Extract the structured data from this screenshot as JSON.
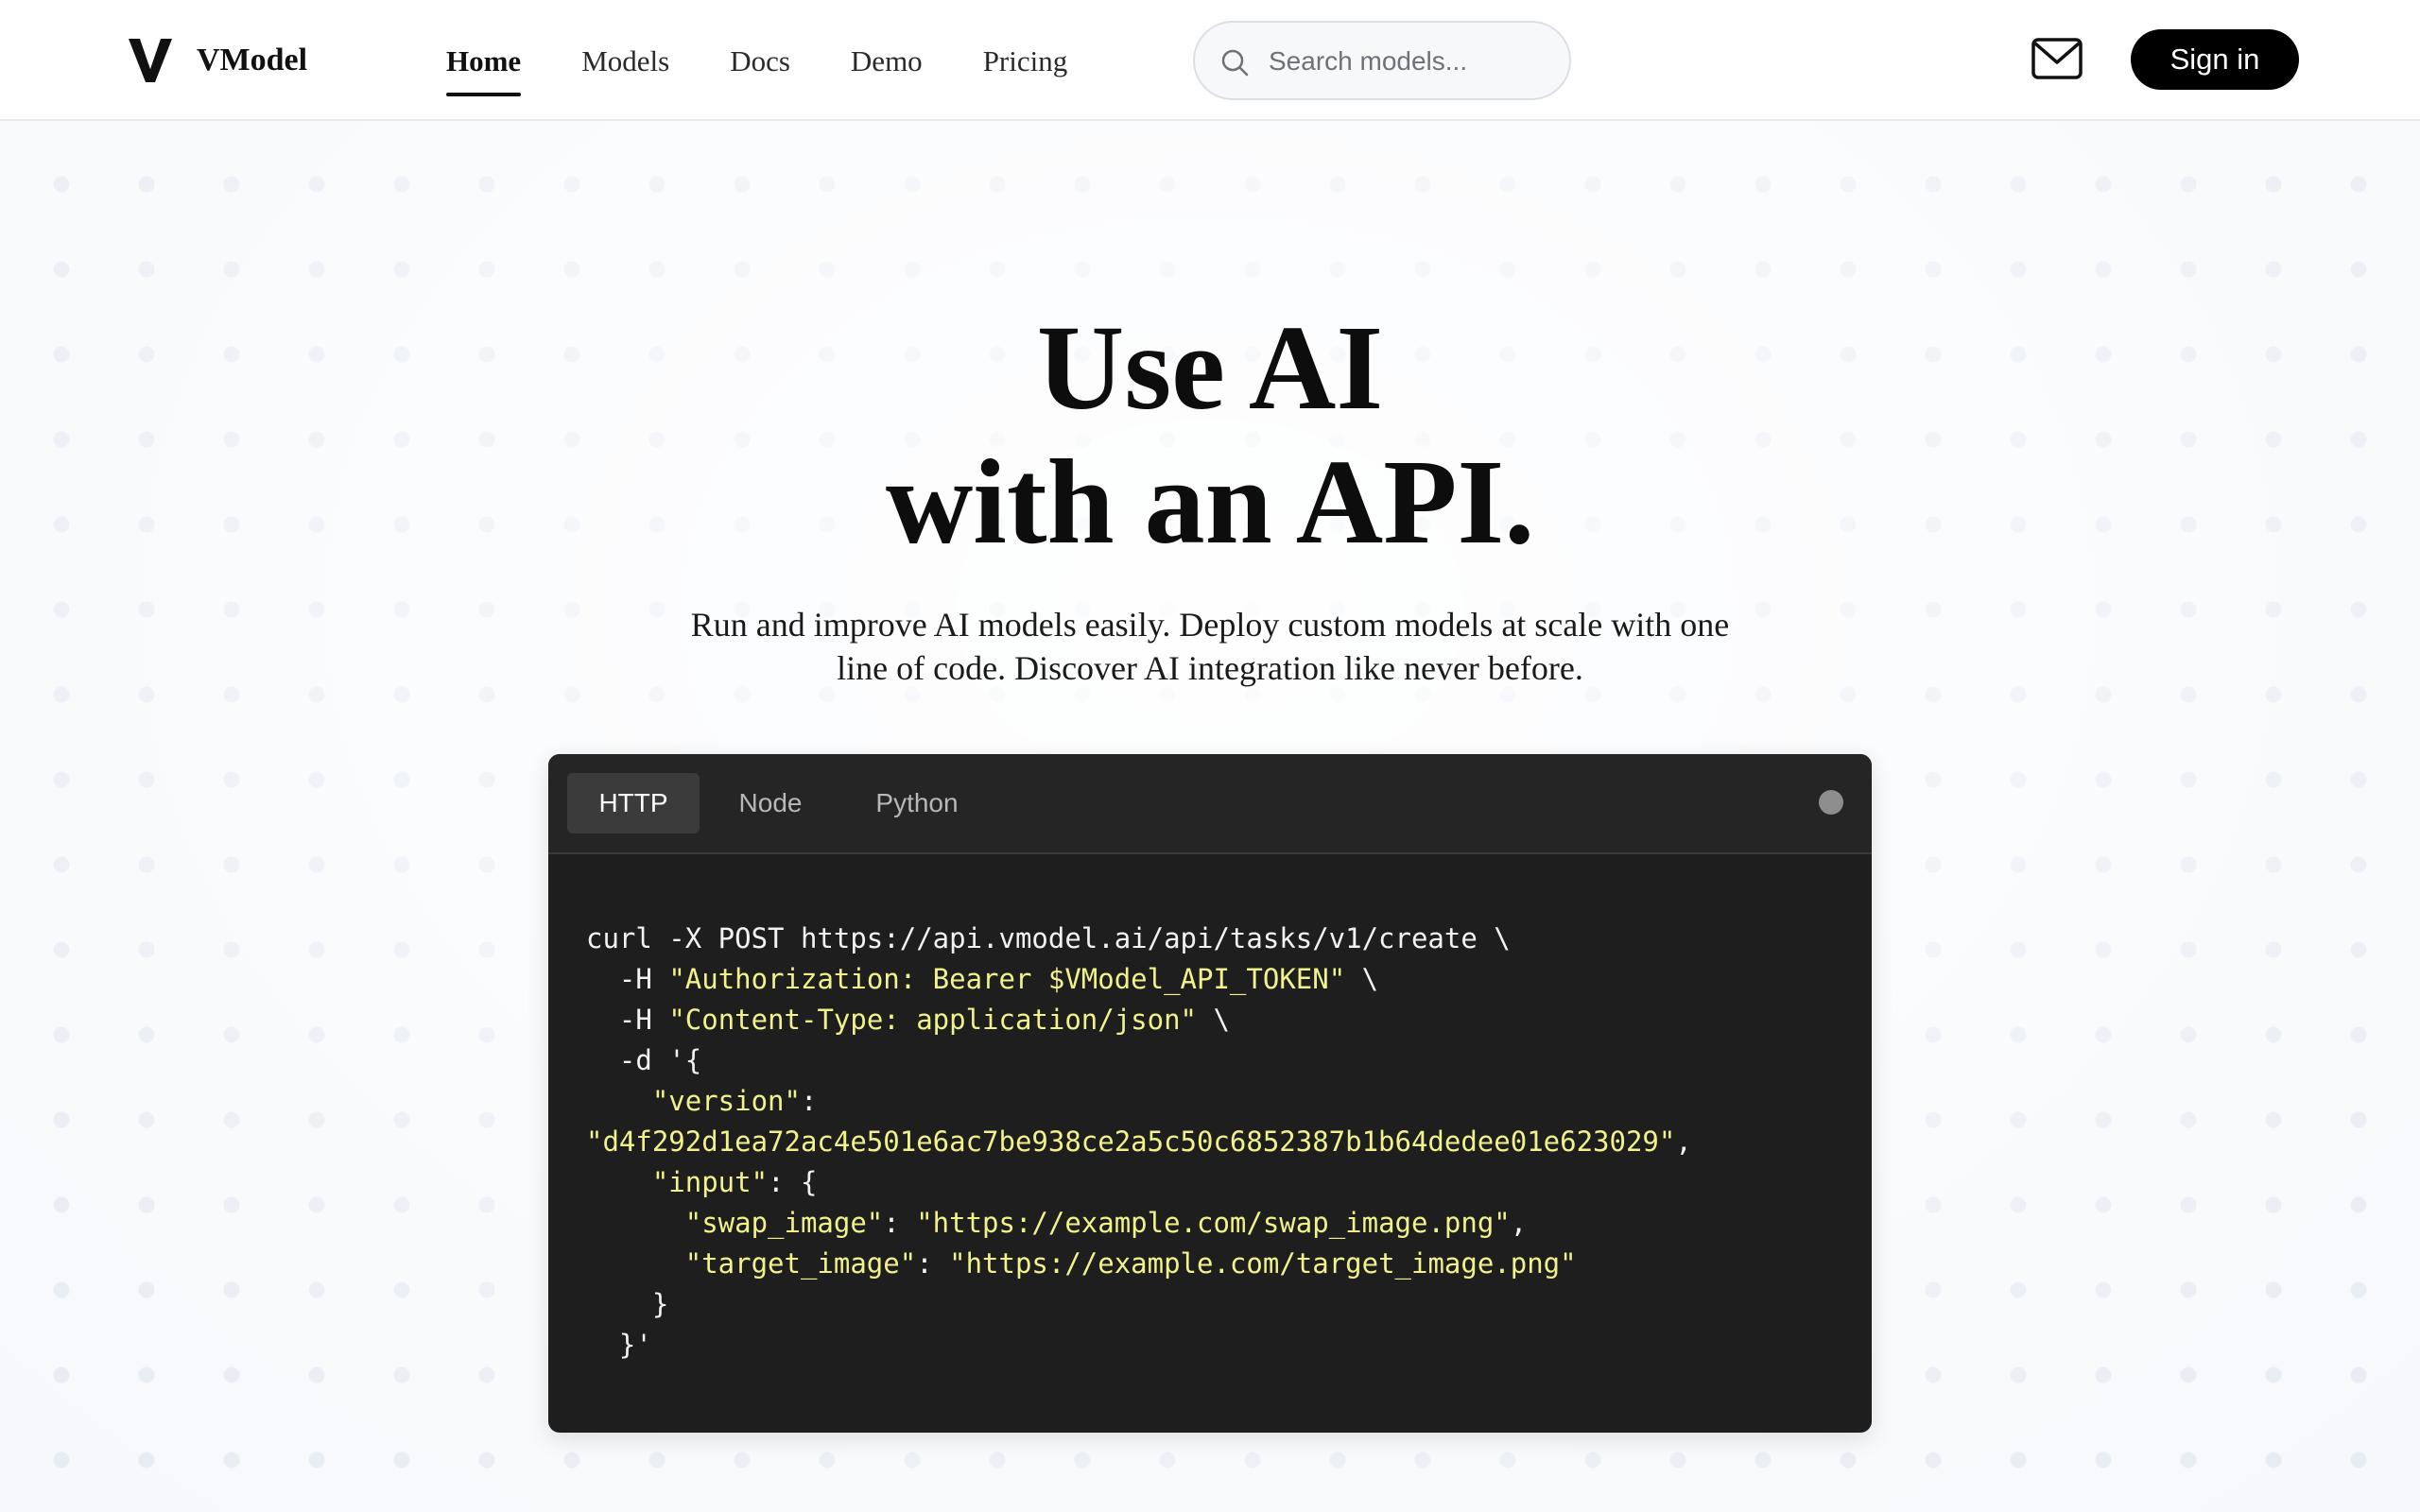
{
  "brand": {
    "name": "VModel"
  },
  "nav": {
    "items": [
      {
        "label": "Home",
        "active": true
      },
      {
        "label": "Models"
      },
      {
        "label": "Docs"
      },
      {
        "label": "Demo"
      },
      {
        "label": "Pricing"
      }
    ]
  },
  "search": {
    "placeholder": "Search models..."
  },
  "header": {
    "signin_label": "Sign in",
    "mail_icon": "mail-icon"
  },
  "hero": {
    "title_line1": "Use AI",
    "title_line2": "with an API.",
    "subtitle_line1": "Run and improve AI models easily. Deploy custom models at scale with one",
    "subtitle_line2": "line of code. Discover AI integration like never before."
  },
  "code_panel": {
    "tabs": [
      "HTTP",
      "Node",
      "Python"
    ],
    "active_tab": "HTTP",
    "lines": {
      "l1": "curl -X POST https://api.vmodel.ai/api/tasks/v1/create \\",
      "l2a": "  -H ",
      "l2s": "\"Authorization: Bearer $VModel_API_TOKEN\"",
      "l2b": " \\",
      "l3a": "  -H ",
      "l3s": "\"Content-Type: application/json\"",
      "l3b": " \\",
      "l4": "  -d '{",
      "l5s": "    \"version\"",
      "l5b": ":",
      "l6s": "\"d4f292d1ea72ac4e501e6ac7be938ce2a5c50c6852387b1b64dedee01e623029\"",
      "l6b": ",",
      "l7s": "    \"input\"",
      "l7b": ": {",
      "l8s1": "      \"swap_image\"",
      "l8b": ": ",
      "l8s2": "\"https://example.com/swap_image.png\"",
      "l8c": ",",
      "l9s1": "      \"target_image\"",
      "l9b": ": ",
      "l9s2": "\"https://example.com/target_image.png\"",
      "l10": "    }",
      "l11": "  }'"
    }
  },
  "colors": {
    "accent": "#000000",
    "code_bg": "#1e1e1e",
    "code_string": "#f1f28a"
  }
}
